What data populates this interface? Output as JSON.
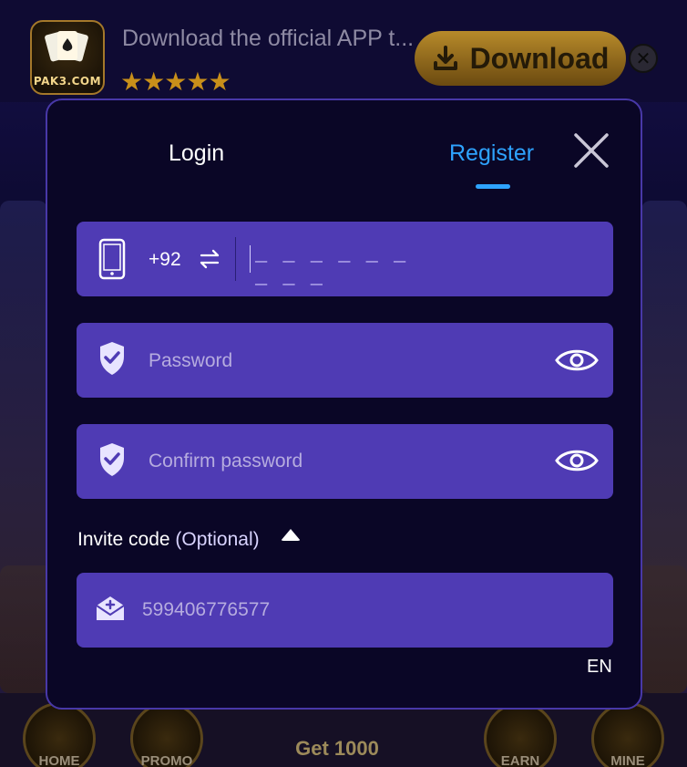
{
  "banner": {
    "title": "Download the official APP t...",
    "logo_text": "PAK3.COM",
    "rating": 5,
    "download_label": "Download",
    "icons": {
      "download": "download-icon",
      "close": "close-icon",
      "star": "star-icon"
    }
  },
  "bottom_nav": {
    "items": [
      {
        "label": "HOME"
      },
      {
        "label": "PROMO"
      },
      {
        "label": "EARN"
      },
      {
        "label": "MINE"
      }
    ],
    "center_label": "Get 1000"
  },
  "modal": {
    "tabs": {
      "login": "Login",
      "register": "Register"
    },
    "active_tab": "Register",
    "colors": {
      "accent": "#2ea3ff",
      "field": "#4f3bb4",
      "panel": "#0a0626",
      "border": "#4838a8"
    },
    "phone": {
      "country_code": "+92",
      "icons": {
        "phone": "phone-icon",
        "swap": "swap-arrows-icon"
      }
    },
    "password": {
      "placeholder": "Password",
      "icons": {
        "shield": "shield-check-icon",
        "eye": "eye-icon"
      }
    },
    "confirm_password": {
      "placeholder": "Confirm password",
      "icons": {
        "shield": "shield-check-icon",
        "eye": "eye-icon"
      }
    },
    "invite": {
      "label": "Invite code",
      "optional": "(Optional)",
      "placeholder": "599406776577",
      "icon": "invite-envelope-icon"
    },
    "language": "EN"
  }
}
